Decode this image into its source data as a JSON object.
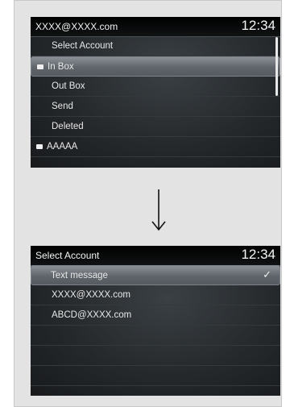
{
  "top_screen": {
    "header_title": "XXXX@XXXX.com",
    "clock": "12:34",
    "items": [
      {
        "label": "Select Account"
      },
      {
        "label": "In Box"
      },
      {
        "label": "Out Box"
      },
      {
        "label": "Send"
      },
      {
        "label": "Deleted"
      },
      {
        "label": "AAAAA"
      }
    ]
  },
  "bottom_screen": {
    "header_title": "Select Account",
    "clock": "12:34",
    "items": [
      {
        "label": "Text message"
      },
      {
        "label": "XXXX@XXXX.com"
      },
      {
        "label": "ABCD@XXXX.com"
      }
    ]
  },
  "colors": {
    "screen_bg": "#25292c",
    "highlight": "#6b7176",
    "text": "#e8e8e8"
  }
}
